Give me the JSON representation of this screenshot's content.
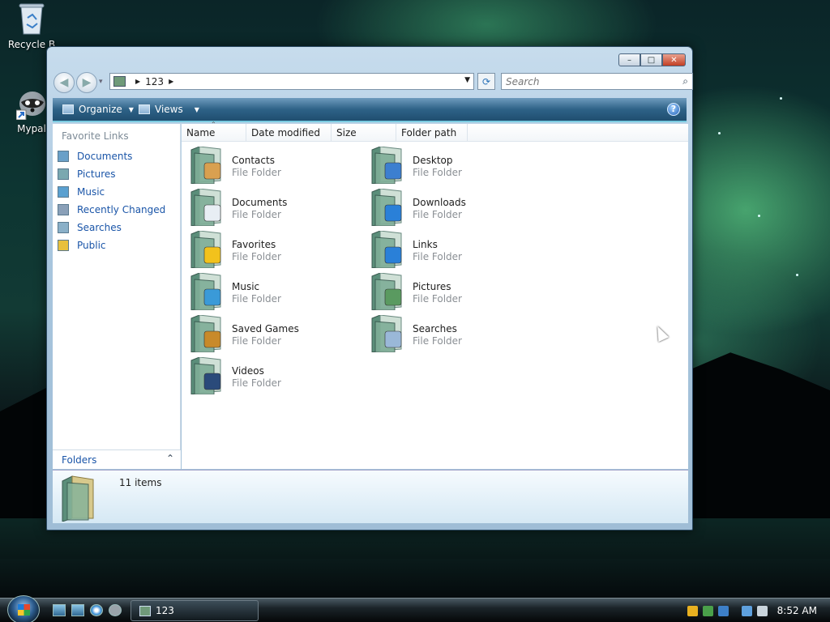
{
  "desktop": {
    "icons": [
      {
        "label": "Recycle B",
        "icon": "recycle-bin-icon"
      },
      {
        "label": "Mypal",
        "icon": "raccoon-icon"
      }
    ]
  },
  "window": {
    "title_buttons": {
      "minimize": "–",
      "maximize": "□",
      "close": "✕"
    },
    "nav": {
      "back": "◀",
      "forward": "▶",
      "history": "▾"
    },
    "address": {
      "path": "123",
      "refresh": "⟳"
    },
    "search": {
      "placeholder": "Search",
      "icon": "⌕"
    },
    "toolbar": {
      "organize": "Organize",
      "views": "Views",
      "help": "?"
    },
    "left_pane": {
      "header": "Favorite Links",
      "links": [
        {
          "label": "Documents",
          "icon": "documents-icon"
        },
        {
          "label": "Pictures",
          "icon": "pictures-icon"
        },
        {
          "label": "Music",
          "icon": "music-icon"
        },
        {
          "label": "Recently Changed",
          "icon": "recently-changed-icon"
        },
        {
          "label": "Searches",
          "icon": "searches-icon"
        },
        {
          "label": "Public",
          "icon": "public-folder-icon"
        }
      ],
      "folders_label": "Folders"
    },
    "columns": [
      "Name",
      "Date modified",
      "Size",
      "Folder path"
    ],
    "items": [
      {
        "name": "Contacts",
        "type": "File Folder",
        "icon": "contacts-folder-icon",
        "color": "#d9a050"
      },
      {
        "name": "Desktop",
        "type": "File Folder",
        "icon": "desktop-folder-icon",
        "color": "#3c7fd0"
      },
      {
        "name": "Documents",
        "type": "File Folder",
        "icon": "documents-folder-icon",
        "color": "#e8eef4"
      },
      {
        "name": "Downloads",
        "type": "File Folder",
        "icon": "downloads-folder-icon",
        "color": "#2a80d8"
      },
      {
        "name": "Favorites",
        "type": "File Folder",
        "icon": "favorites-folder-icon",
        "color": "#f2c21c"
      },
      {
        "name": "Links",
        "type": "File Folder",
        "icon": "links-folder-icon",
        "color": "#2a80d8"
      },
      {
        "name": "Music",
        "type": "File Folder",
        "icon": "music-folder-icon",
        "color": "#3a9ad8"
      },
      {
        "name": "Pictures",
        "type": "File Folder",
        "icon": "pictures-folder-icon",
        "color": "#5a9a60"
      },
      {
        "name": "Saved Games",
        "type": "File Folder",
        "icon": "saved-games-folder-icon",
        "color": "#c88a2a"
      },
      {
        "name": "Searches",
        "type": "File Folder",
        "icon": "searches-folder-icon",
        "color": "#9ab8d8"
      },
      {
        "name": "Videos",
        "type": "File Folder",
        "icon": "videos-folder-icon",
        "color": "#2a4a7a"
      }
    ],
    "details": {
      "count": "11 items"
    }
  },
  "taskbar": {
    "task_label": "123",
    "clock": "8:52 AM"
  }
}
